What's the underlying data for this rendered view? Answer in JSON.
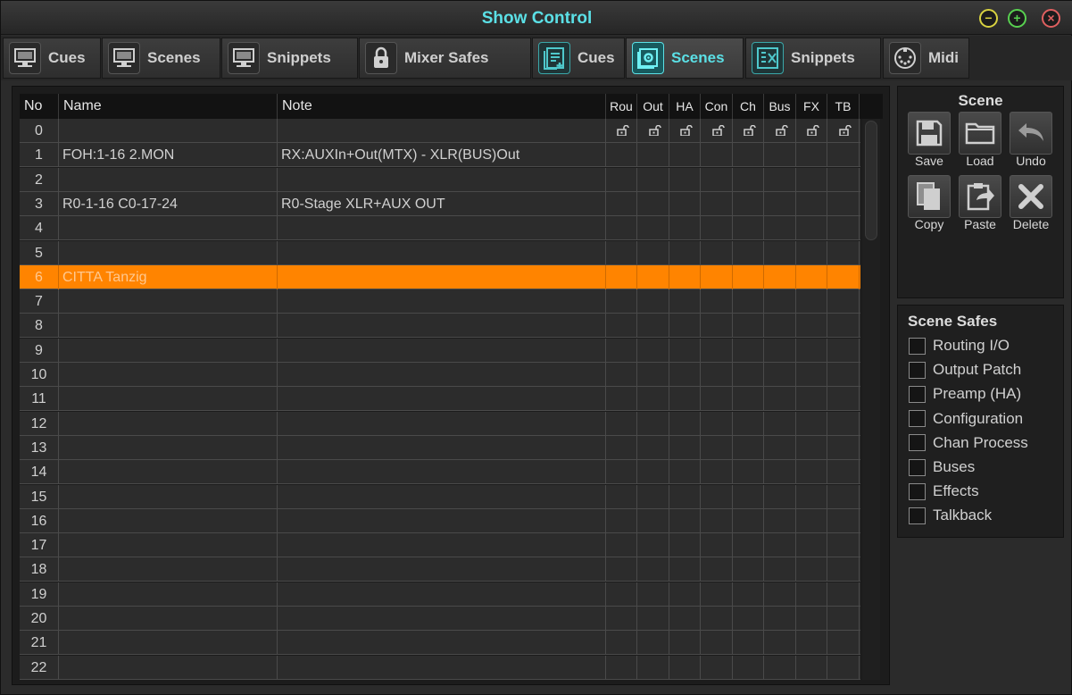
{
  "window": {
    "title": "Show Control",
    "controls": {
      "minimize": "−",
      "pin": "+",
      "close": "×"
    }
  },
  "tabs": [
    {
      "label": "Cues",
      "icon": "monitor-icon",
      "style": "grey",
      "active": false
    },
    {
      "label": "Scenes",
      "icon": "monitor-icon",
      "style": "grey",
      "active": false
    },
    {
      "label": "Snippets",
      "icon": "monitor-icon",
      "style": "grey",
      "active": false
    },
    {
      "label": "Mixer Safes",
      "icon": "lock-icon",
      "style": "grey",
      "active": false
    },
    {
      "label": "Cues",
      "icon": "cue-list-icon",
      "style": "teal",
      "active": false
    },
    {
      "label": "Scenes",
      "icon": "scene-icon",
      "style": "teal",
      "active": true
    },
    {
      "label": "Snippets",
      "icon": "snippet-icon",
      "style": "teal",
      "active": false
    },
    {
      "label": "Midi",
      "icon": "midi-icon",
      "style": "grey",
      "active": false
    }
  ],
  "table": {
    "columns": [
      "No",
      "Name",
      "Note",
      "Rou",
      "Out",
      "HA",
      "Con",
      "Ch",
      "Bus",
      "FX",
      "TB"
    ],
    "rows": [
      {
        "no": "0",
        "name": "",
        "note": "",
        "locks": true
      },
      {
        "no": "1",
        "name": "FOH:1-16 2.MON",
        "note": "RX:AUXIn+Out(MTX) - XLR(BUS)Out"
      },
      {
        "no": "2",
        "name": "",
        "note": ""
      },
      {
        "no": "3",
        "name": "R0-1-16 C0-17-24",
        "note": "R0-Stage XLR+AUX OUT"
      },
      {
        "no": "4",
        "name": "",
        "note": ""
      },
      {
        "no": "5",
        "name": "",
        "note": ""
      },
      {
        "no": "6",
        "name": "CITTA Tanzig",
        "note": "",
        "selected": true
      },
      {
        "no": "7",
        "name": "",
        "note": ""
      },
      {
        "no": "8",
        "name": "",
        "note": ""
      },
      {
        "no": "9",
        "name": "",
        "note": ""
      },
      {
        "no": "10",
        "name": "",
        "note": ""
      },
      {
        "no": "11",
        "name": "",
        "note": ""
      },
      {
        "no": "12",
        "name": "",
        "note": ""
      },
      {
        "no": "13",
        "name": "",
        "note": ""
      },
      {
        "no": "14",
        "name": "",
        "note": ""
      },
      {
        "no": "15",
        "name": "",
        "note": ""
      },
      {
        "no": "16",
        "name": "",
        "note": ""
      },
      {
        "no": "17",
        "name": "",
        "note": ""
      },
      {
        "no": "18",
        "name": "",
        "note": ""
      },
      {
        "no": "19",
        "name": "",
        "note": ""
      },
      {
        "no": "20",
        "name": "",
        "note": ""
      },
      {
        "no": "21",
        "name": "",
        "note": ""
      },
      {
        "no": "22",
        "name": "",
        "note": ""
      }
    ]
  },
  "scene_panel": {
    "title": "Scene",
    "buttons": [
      {
        "label": "Save",
        "icon": "save-icon"
      },
      {
        "label": "Load",
        "icon": "folder-icon"
      },
      {
        "label": "Undo",
        "icon": "undo-icon"
      },
      {
        "label": "Copy",
        "icon": "copy-icon"
      },
      {
        "label": "Paste",
        "icon": "paste-icon"
      },
      {
        "label": "Delete",
        "icon": "delete-icon"
      }
    ]
  },
  "safes_panel": {
    "title": "Scene Safes",
    "items": [
      "Routing I/O",
      "Output Patch",
      "Preamp (HA)",
      "Configuration",
      "Chan Process",
      "Buses",
      "Effects",
      "Talkback"
    ]
  },
  "colors": {
    "accent": "#5be0e6",
    "selection": "#ff8400",
    "background": "#2b2b2b"
  }
}
